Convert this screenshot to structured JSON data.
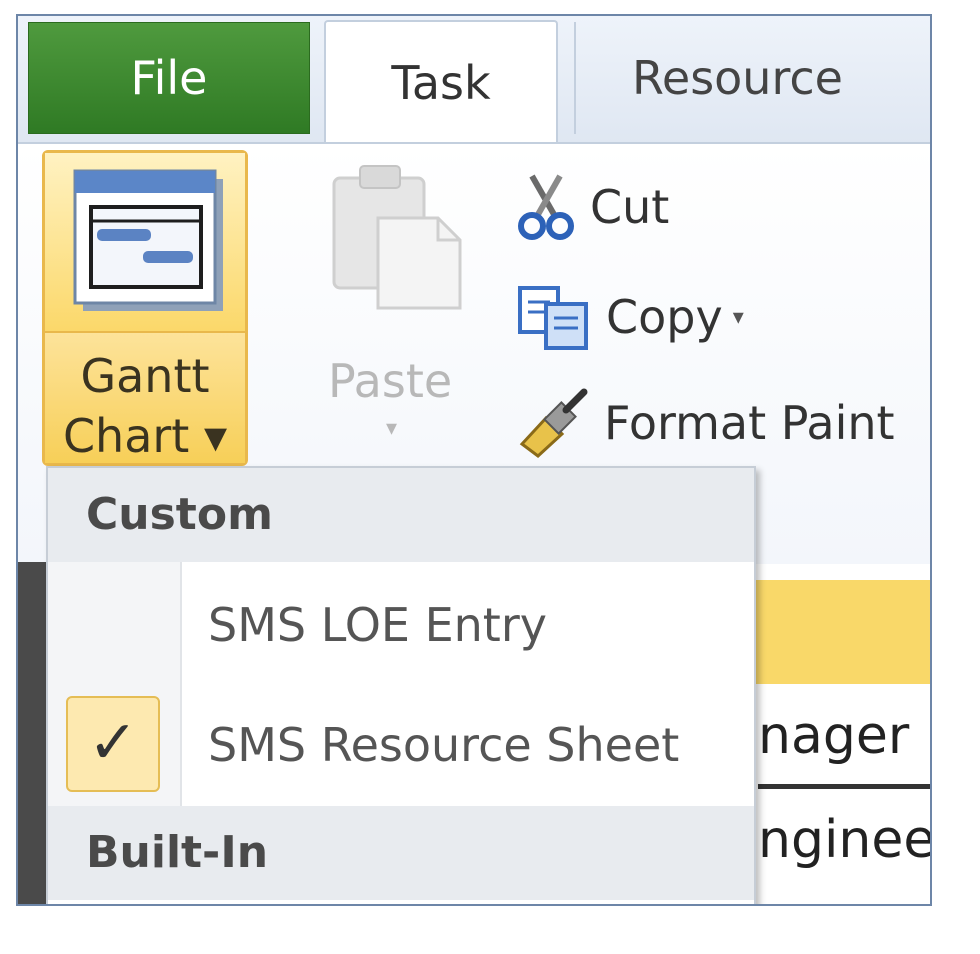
{
  "tabs": {
    "file": "File",
    "task": "Task",
    "resource": "Resource"
  },
  "ribbon": {
    "gantt_line1": "Gantt",
    "gantt_line2": "Chart ▾",
    "paste": "Paste",
    "paste_arrow": "▾",
    "cut": "Cut",
    "copy": "Copy",
    "copy_arrow": "▾",
    "format_painter": "Format Paint"
  },
  "background_sheet": {
    "row1": "nager",
    "row2": "nginee"
  },
  "menu": {
    "section_custom": "Custom",
    "section_builtin": "Built-In",
    "items": [
      {
        "label": "SMS LOE Entry",
        "checked": false
      },
      {
        "label": "SMS Resource Sheet",
        "checked": true,
        "check_glyph": "✓"
      }
    ]
  },
  "colors": {
    "file_tab": "#3d8a2f",
    "selected_yellow": "#fbd86a",
    "frame": "#6d86a8"
  }
}
